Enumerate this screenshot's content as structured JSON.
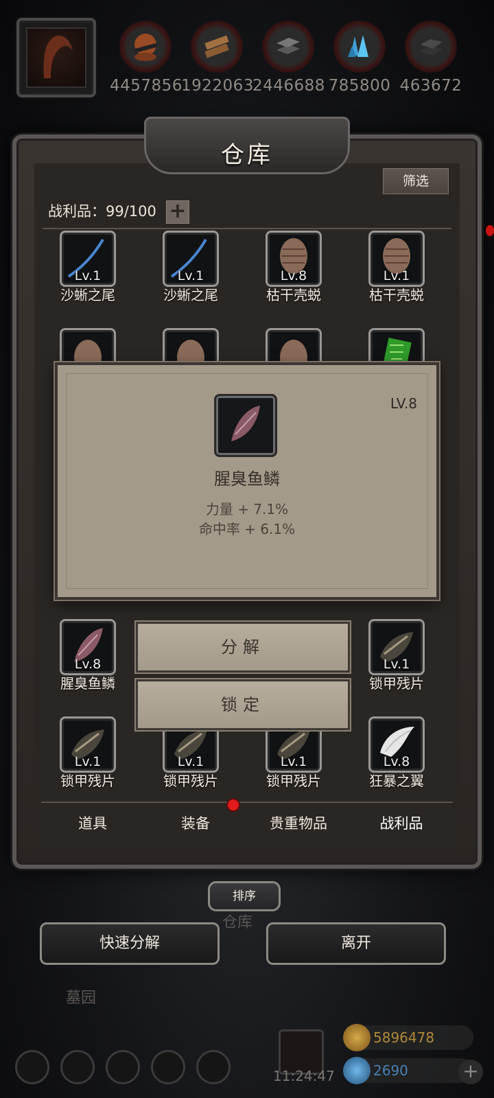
{
  "resources": [
    {
      "icon": "ore-icon",
      "value": "4457856"
    },
    {
      "icon": "wood-icon",
      "value": "1922063"
    },
    {
      "icon": "iron-icon",
      "value": "2446688"
    },
    {
      "icon": "crystal-icon",
      "value": "785800"
    },
    {
      "icon": "ingot-icon",
      "value": "463672"
    }
  ],
  "panel": {
    "title": "仓库",
    "filter_label": "筛选",
    "loot_count": "战利品：99/100",
    "add_label": "+"
  },
  "row1": [
    {
      "level": "Lv.1",
      "name": "沙蜥之尾",
      "icon": "tail-icon"
    },
    {
      "level": "Lv.1",
      "name": "沙蜥之尾",
      "icon": "tail-icon"
    },
    {
      "level": "Lv.8",
      "name": "枯干壳蜕",
      "icon": "shell-icon"
    },
    {
      "level": "Lv.1",
      "name": "枯干壳蜕",
      "icon": "shell-icon"
    }
  ],
  "row3": [
    {
      "level": "Lv.8",
      "name": "腥臭鱼鳞",
      "icon": "scale-icon"
    },
    {
      "level": "Lv.1",
      "name": "锁甲残片",
      "icon": "chainmail-icon"
    }
  ],
  "row4": [
    {
      "level": "Lv.1",
      "name": "锁甲残片",
      "icon": "chainmail-icon"
    },
    {
      "level": "Lv.1",
      "name": "锁甲残片",
      "icon": "chainmail-icon"
    },
    {
      "level": "Lv.1",
      "name": "锁甲残片",
      "icon": "chainmail-icon"
    },
    {
      "level": "Lv.8",
      "name": "狂暴之翼",
      "icon": "wing-icon"
    }
  ],
  "popup": {
    "level": "LV.8",
    "name": "腥臭鱼鳞",
    "stat1": "力量 + 7.1%",
    "stat2": "命中率 + 6.1%"
  },
  "actions": {
    "decompose": "分解",
    "lock": "锁定"
  },
  "tabs": [
    "道具",
    "装备",
    "贵重物品",
    "战利品"
  ],
  "active_tab": "战利品",
  "sort_label": "排序",
  "bottom": {
    "quick_decompose": "快速分解",
    "leave": "离开",
    "ghost_warehouse": "仓库",
    "ghost_graveyard": "墓园"
  },
  "hud": {
    "gold": "5896478",
    "gems": "2690",
    "time": "11:24:47"
  },
  "colors": {
    "red_dot": "#e11b1b",
    "gold_text": "#b08a3a",
    "gem_text": "#4a7fb0"
  }
}
